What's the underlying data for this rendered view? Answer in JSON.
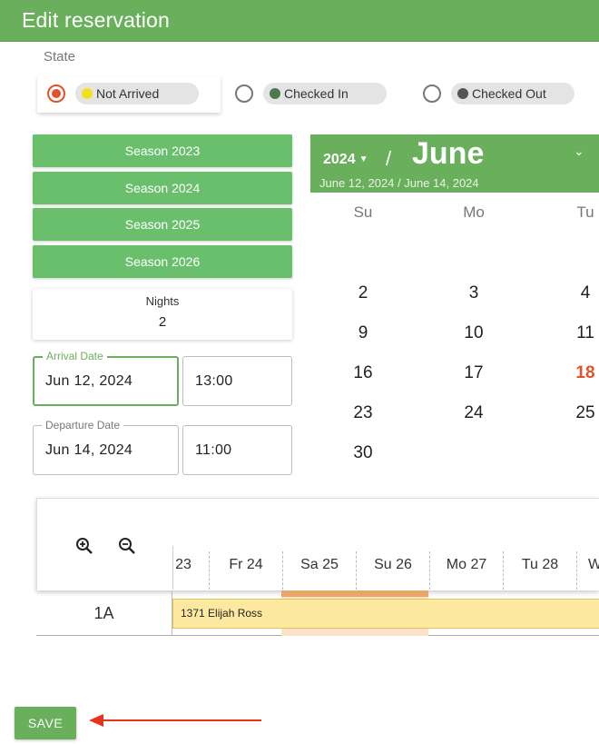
{
  "header": {
    "title": "Edit reservation"
  },
  "state": {
    "label": "State",
    "options": [
      {
        "label": "Not Arrived",
        "dot_color": "#f2e21a",
        "selected": true
      },
      {
        "label": "Checked In",
        "dot_color": "#4a7a4e",
        "selected": false
      },
      {
        "label": "Checked Out",
        "dot_color": "#555555",
        "selected": false
      }
    ]
  },
  "seasons": [
    "Season 2023",
    "Season 2024",
    "Season 2025",
    "Season 2026"
  ],
  "nights": {
    "label": "Nights",
    "value": "2"
  },
  "arrival": {
    "label": "Arrival Date",
    "date": "Jun 12, 2024",
    "time": "13:00"
  },
  "departure": {
    "label": "Departure Date",
    "date": "Jun 14, 2024",
    "time": "11:00"
  },
  "calendar": {
    "year": "2024",
    "separator": "/",
    "month": "June",
    "range": "June 12, 2024 / June 14, 2024",
    "weekdays": [
      "Su",
      "Mo",
      "Tu"
    ],
    "rows": [
      [
        "2",
        "3",
        "4"
      ],
      [
        "9",
        "10",
        "11"
      ],
      [
        "16",
        "17",
        "18"
      ],
      [
        "23",
        "24",
        "25"
      ],
      [
        "30",
        "",
        ""
      ]
    ],
    "today": "18",
    "accent_color": "#e2522a"
  },
  "timeline": {
    "dates": [
      "23",
      "Fr 24",
      "Sa 25",
      "Su 26",
      "Mo 27",
      "Tu 28",
      "W"
    ],
    "row_label": "1A",
    "booking_label": "1371 Elijah Ross"
  },
  "save_label": "SAVE",
  "colors": {
    "primary": "#6aaf5c",
    "season_button": "#6abf6c",
    "booking": "#fde99f",
    "arrow": "#e8321e"
  }
}
